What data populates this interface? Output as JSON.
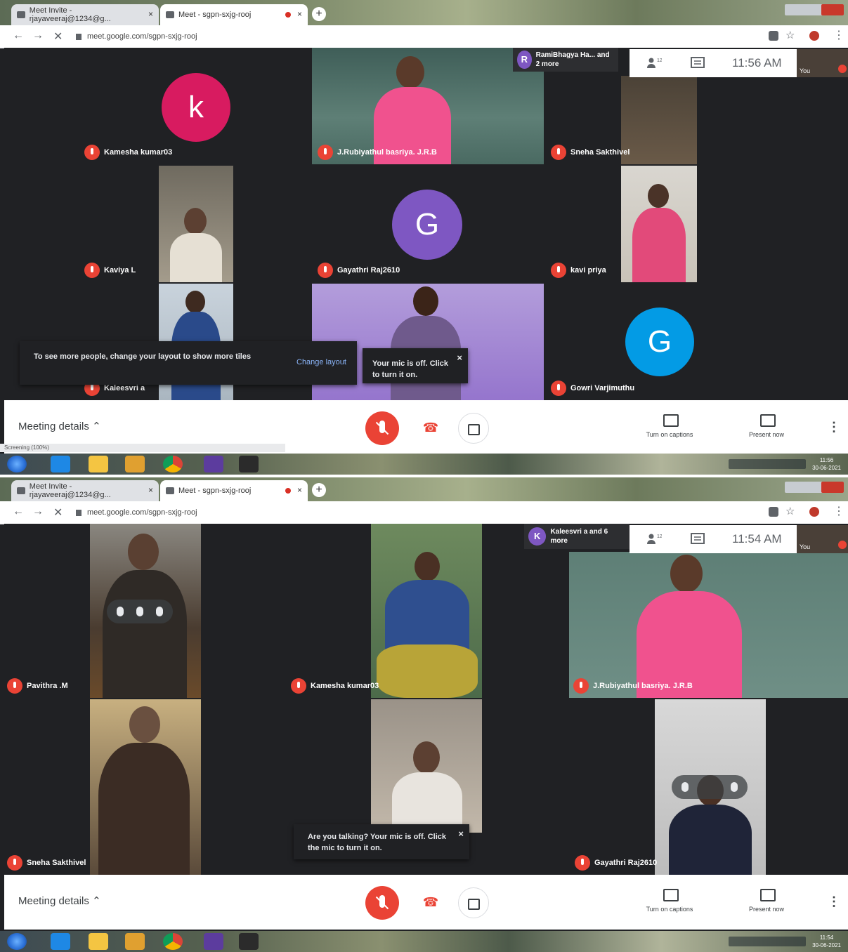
{
  "screens": [
    {
      "tabs": [
        {
          "label": "Meet Invite - rjayaveeraj@1234@g..."
        },
        {
          "label": "Meet - sgpn-sxjg-rooj"
        }
      ],
      "url": "meet.google.com/sgpn-sxjg-rooj",
      "clock": "11:56 AM",
      "people_count": "12",
      "participants_chip": {
        "initial": "R",
        "text": "RamiBhagya Ha... and 2 more"
      },
      "self_label": "You",
      "tiles": [
        {
          "name": "Kamesha kumar03",
          "avatar": "k"
        },
        {
          "name": "J.Rubiyathul basriya. J.R.B"
        },
        {
          "name": "Sneha Sakthivel"
        },
        {
          "name": "Kaviya L"
        },
        {
          "name": "Gayathri Raj2610",
          "avatar": "G"
        },
        {
          "name": "kavi priya"
        },
        {
          "name": "Kaleesvri a"
        },
        {
          "name": "Gowri Varjimuthu",
          "avatar": "G"
        }
      ],
      "toast_layout": {
        "text": "To see more people, change your layout to show more tiles",
        "action": "Change layout"
      },
      "toast_mic": {
        "text": "Your mic is off. Click to turn it on."
      },
      "controls": {
        "details": "Meeting details",
        "captions": "Turn on captions",
        "present": "Present now"
      },
      "status": "Screening (100%)",
      "taskbar_time": "11:56",
      "taskbar_date": "30-06-2021"
    },
    {
      "tabs": [
        {
          "label": "Meet Invite - rjayaveeraj@1234@g..."
        },
        {
          "label": "Meet - sgpn-sxjg-rooj"
        }
      ],
      "url": "meet.google.com/sgpn-sxjg-rooj",
      "clock": "11:54 AM",
      "people_count": "12",
      "participants_chip": {
        "initial": "K",
        "text": "Kaleesvri a and 6 more"
      },
      "self_label": "You",
      "tiles": [
        {
          "name": "Pavithra .M"
        },
        {
          "name": "Kamesha kumar03"
        },
        {
          "name": "J.Rubiyathul basriya. J.R.B"
        },
        {
          "name": "Sneha Sakthivel"
        },
        {
          "name": ""
        },
        {
          "name": "Gayathri Raj2610"
        }
      ],
      "toast_mic": {
        "text": "Are you talking? Your mic is off. Click the mic to turn it on."
      },
      "controls": {
        "details": "Meeting details",
        "captions": "Turn on captions",
        "present": "Present now"
      },
      "taskbar_time": "11:54",
      "taskbar_date": "30-06-2021"
    }
  ],
  "colors": {
    "mic_off": "#ea4335",
    "avatar_k": "#d81b60",
    "avatar_g_purple": "#7e57c2",
    "avatar_g_blue": "#039be5",
    "meet_bg": "#202124"
  },
  "icons": [
    "back-arrow-icon",
    "forward-arrow-icon",
    "close-icon",
    "lock-icon",
    "star-icon",
    "people-icon",
    "chat-icon",
    "mic-off-icon",
    "hangup-icon",
    "camera-icon",
    "captions-icon",
    "present-icon",
    "more-vert-icon",
    "windows-start-icon",
    "ie-icon",
    "folder-icon",
    "chrome-icon"
  ]
}
